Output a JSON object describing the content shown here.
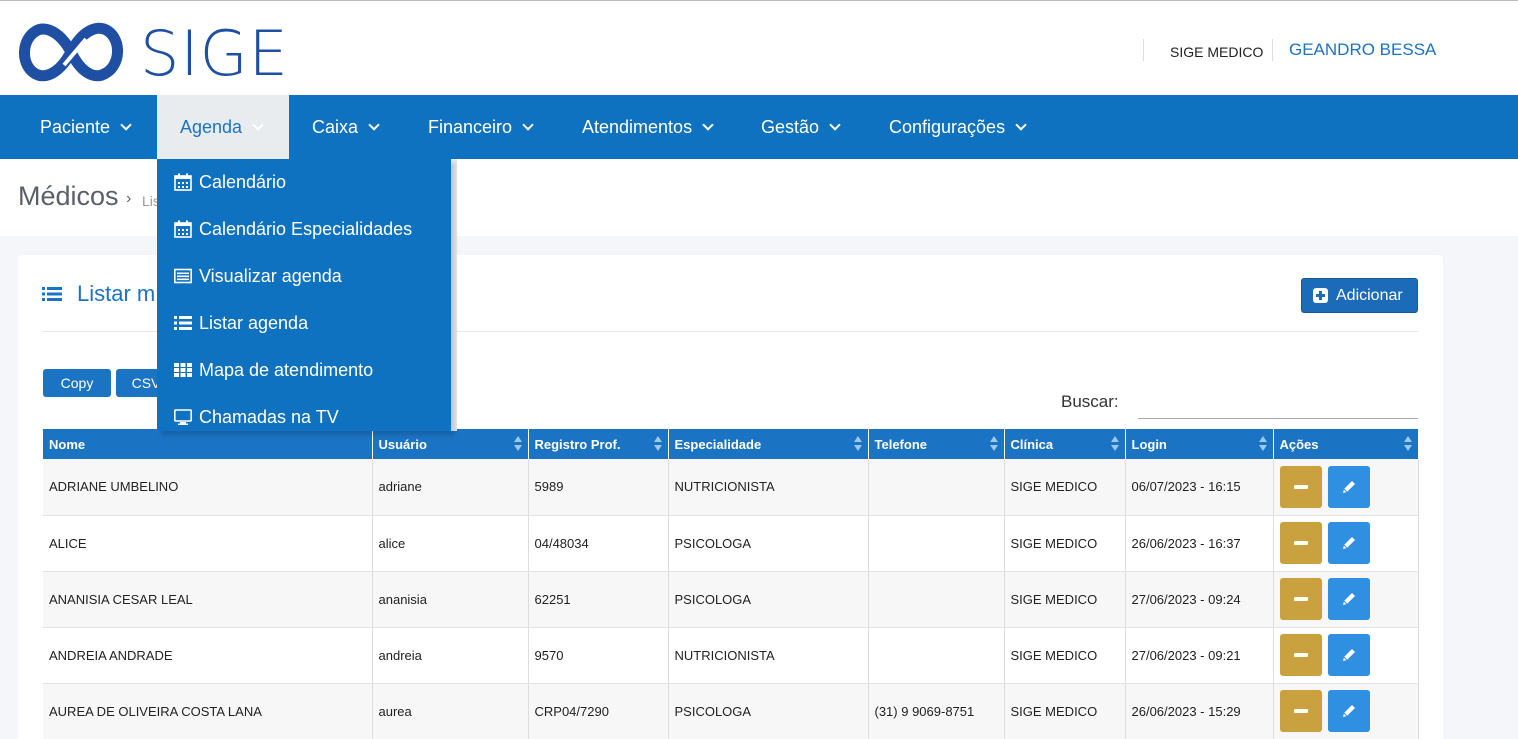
{
  "brand": {
    "logo_text": "SIGE"
  },
  "header": {
    "company": "SIGE MEDICO",
    "user": "GEANDRO BESSA"
  },
  "nav": {
    "items": [
      {
        "label": "Paciente"
      },
      {
        "label": "Agenda"
      },
      {
        "label": "Caixa"
      },
      {
        "label": "Financeiro"
      },
      {
        "label": "Atendimentos"
      },
      {
        "label": "Gestão"
      },
      {
        "label": "Configurações"
      }
    ]
  },
  "dropdown": {
    "items": [
      {
        "label": "Calendário",
        "icon": "calendar-icon"
      },
      {
        "label": "Calendário Especialidades",
        "icon": "calendar-icon"
      },
      {
        "label": "Visualizar agenda",
        "icon": "list-alt-icon"
      },
      {
        "label": "Listar agenda",
        "icon": "list-icon"
      },
      {
        "label": "Mapa de atendimento",
        "icon": "grid-icon"
      },
      {
        "label": "Chamadas na TV",
        "icon": "tv-icon"
      }
    ]
  },
  "breadcrumb": {
    "title": "Médicos",
    "sub": "Lis"
  },
  "panel": {
    "title": "Listar m",
    "add_label": "Adicionar",
    "export_buttons": [
      "Copy",
      "CSV"
    ],
    "search_label": "Buscar:",
    "search_value": ""
  },
  "table": {
    "columns": [
      "Nome",
      "Usuário",
      "Registro Prof.",
      "Especialidade",
      "Telefone",
      "Clínica",
      "Login",
      "Ações"
    ],
    "rows": [
      [
        "ADRIANE UMBELINO",
        "adriane",
        "5989",
        "NUTRICIONISTA",
        "",
        "SIGE MEDICO",
        "06/07/2023 - 16:15"
      ],
      [
        "ALICE",
        "alice",
        "04/48034",
        "PSICOLOGA",
        "",
        "SIGE MEDICO",
        "26/06/2023 - 16:37"
      ],
      [
        "ANANISIA CESAR LEAL",
        "ananisia",
        "62251",
        "PSICOLOGA",
        "",
        "SIGE MEDICO",
        "27/06/2023 - 09:24"
      ],
      [
        "ANDREIA ANDRADE",
        "andreia",
        "9570",
        "NUTRICIONISTA",
        "",
        "SIGE MEDICO",
        "27/06/2023 - 09:21"
      ],
      [
        "AUREA DE OLIVEIRA COSTA LANA",
        "aurea",
        "CRP04/7290",
        "PSICOLOGA",
        "(31) 9 9069-8751",
        "SIGE MEDICO",
        "26/06/2023 - 15:29"
      ]
    ]
  },
  "colors": {
    "primary": "#0f72c0",
    "accent": "#1b73c4",
    "delete": "#c9a13f",
    "edit": "#2f8fe0"
  }
}
